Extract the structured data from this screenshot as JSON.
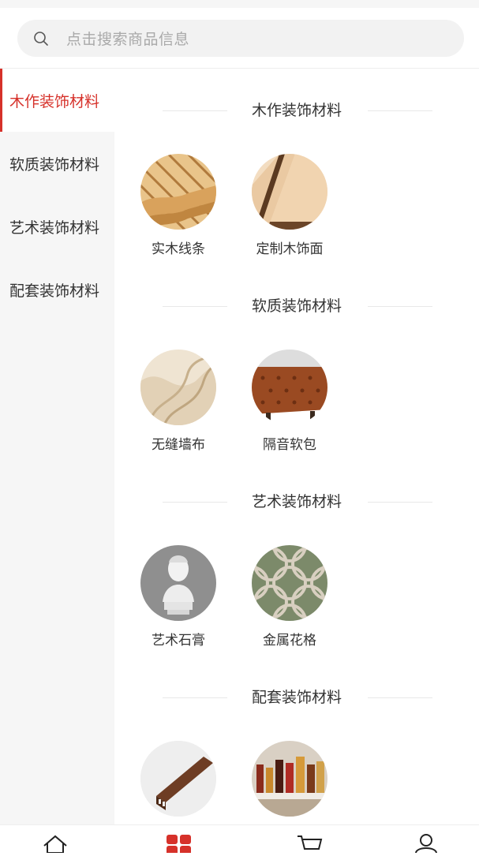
{
  "search": {
    "placeholder": "点击搜索商品信息",
    "icon": "search-icon"
  },
  "sidebar": {
    "items": [
      {
        "label": "木作装饰材料",
        "active": true
      },
      {
        "label": "软质装饰材料",
        "active": false
      },
      {
        "label": "艺术装饰材料",
        "active": false
      },
      {
        "label": "配套装饰材料",
        "active": false
      }
    ]
  },
  "sections": [
    {
      "title": "木作装饰材料",
      "items": [
        {
          "label": "实木线条"
        },
        {
          "label": "定制木饰面"
        }
      ]
    },
    {
      "title": "软质装饰材料",
      "items": [
        {
          "label": "无缝墙布"
        },
        {
          "label": "隔音软包"
        }
      ]
    },
    {
      "title": "艺术装饰材料",
      "items": [
        {
          "label": "艺术石膏"
        },
        {
          "label": "金属花格"
        }
      ]
    },
    {
      "title": "配套装饰材料",
      "items": [
        {
          "label": ""
        },
        {
          "label": ""
        }
      ]
    }
  ],
  "tabbar": {
    "items": [
      {
        "icon": "home-icon",
        "active": false
      },
      {
        "icon": "category-icon",
        "active": true
      },
      {
        "icon": "cart-icon",
        "active": false
      },
      {
        "icon": "user-icon",
        "active": false
      }
    ]
  },
  "colors": {
    "accent": "#d6312a",
    "sidebar_bg": "#f6f6f6",
    "search_bg": "#f2f2f2"
  }
}
